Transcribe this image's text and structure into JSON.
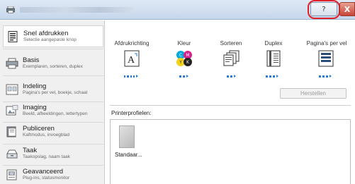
{
  "window": {
    "help_label": "?",
    "close_label": "X"
  },
  "sidebar": {
    "items": [
      {
        "title": "Snel afdrukken",
        "subtitle": "Selectie aangepaste knop"
      },
      {
        "title": "Basis",
        "subtitle": "Exemplaren, sorteren, duplex"
      },
      {
        "title": "Indeling",
        "subtitle": "Pagina's per vel, boekje, schaal"
      },
      {
        "title": "Imaging",
        "subtitle": "Beeld, afbeeldingen, lettertypen"
      },
      {
        "title": "Publiceren",
        "subtitle": "Kaftmodus, invoegblad"
      },
      {
        "title": "Taak",
        "subtitle": "Taakopslag, naam taak"
      },
      {
        "title": "Geavanceerd",
        "subtitle": "Plug-ins, statusmonitor"
      }
    ]
  },
  "quick_print": {
    "columns": [
      {
        "label": "Afdrukrichting",
        "icon": "orientation-icon"
      },
      {
        "label": "Kleur",
        "icon": "color-cmyk-icon"
      },
      {
        "label": "Sorteren",
        "icon": "collate-icon"
      },
      {
        "label": "Duplex",
        "icon": "duplex-icon"
      },
      {
        "label": "Pagina's per vel",
        "icon": "pages-per-sheet-icon"
      }
    ],
    "color_letters": {
      "c": "C",
      "m": "M",
      "y": "Y",
      "k": "K"
    },
    "orientation_letter": "A",
    "reset_label": "Herstellen"
  },
  "profiles": {
    "label": "Printerprofielen:",
    "items": [
      {
        "name": "Standaar..."
      }
    ]
  },
  "colors": {
    "accent_blue": "#2b7bd6",
    "cyan": "#00a9e0",
    "magenta": "#d6248f",
    "yellow": "#f2d21b",
    "black": "#222222",
    "help_highlight": "#e0202a"
  }
}
